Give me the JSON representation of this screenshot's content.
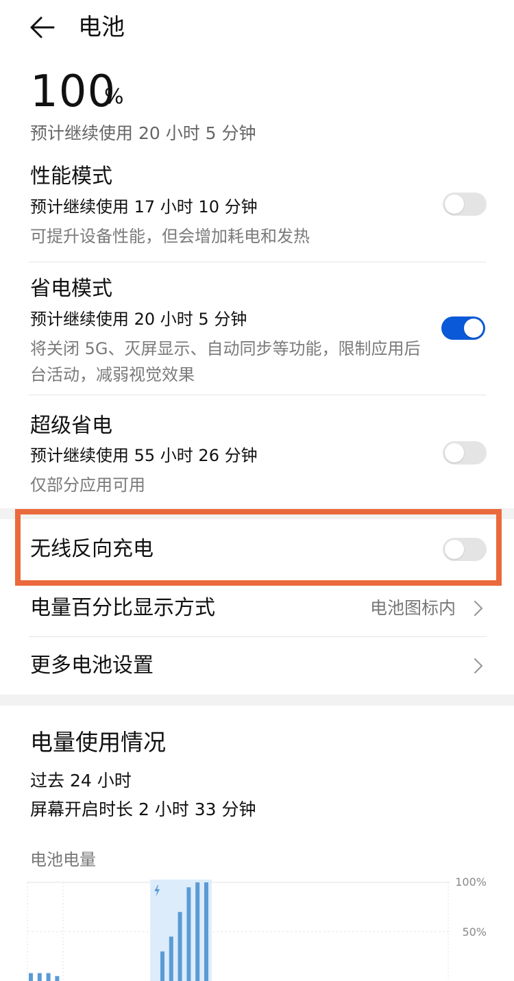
{
  "header": {
    "title": "电池"
  },
  "battery": {
    "percent": "100",
    "percent_sign": "%",
    "estimate": "预计继续使用 20 小时 5 分钟"
  },
  "modes": [
    {
      "title": "性能模式",
      "estimate": "预计继续使用 17 小时 10 分钟",
      "desc": "可提升设备性能，但会增加耗电和发热",
      "enabled": false
    },
    {
      "title": "省电模式",
      "estimate": "预计继续使用 20 小时 5 分钟",
      "desc": "将关闭 5G、灭屏显示、自动同步等功能，限制应用后台活动，减弱视觉效果",
      "enabled": true
    },
    {
      "title": "超级省电",
      "estimate": "预计继续使用 55 小时 26 分钟",
      "desc": "仅部分应用可用",
      "enabled": false
    }
  ],
  "wireless_reverse": {
    "label": "无线反向充电",
    "enabled": false
  },
  "percent_display": {
    "label": "电量百分比显示方式",
    "value": "电池图标内"
  },
  "more_settings": {
    "label": "更多电池设置"
  },
  "usage": {
    "title": "电量使用情况",
    "period": "过去 24 小时",
    "screen_on": "屏幕开启时长 2 小时 33 分钟",
    "chart_label": "电池电量"
  },
  "colors": {
    "accent": "#0a59d8",
    "highlight": "#ea6a3d",
    "bar": "#5b9bd5",
    "charging_band": "#dcecfa"
  },
  "chart_data": {
    "type": "bar",
    "ylabel": "电池电量",
    "ytick_labels": [
      "100%",
      "50%"
    ],
    "ylim": [
      0,
      100
    ],
    "values": [
      8,
      8,
      8,
      5,
      null,
      null,
      null,
      null,
      null,
      null,
      null,
      null,
      null,
      null,
      null,
      30,
      45,
      70,
      95,
      100,
      100
    ],
    "charging_range": [
      14,
      21
    ]
  }
}
